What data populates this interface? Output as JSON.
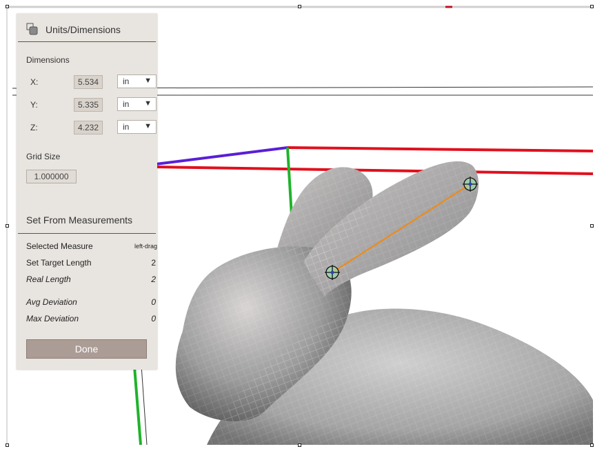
{
  "panel": {
    "title": "Units/Dimensions",
    "dimensions_heading": "Dimensions",
    "rows": [
      {
        "axis": "X:",
        "value": "5.534",
        "unit": "in"
      },
      {
        "axis": "Y:",
        "value": "5.335",
        "unit": "in"
      },
      {
        "axis": "Z:",
        "value": "4.232",
        "unit": "in"
      }
    ],
    "grid_heading": "Grid Size",
    "grid_value": "1.000000",
    "measure_heading": "Set From Measurements",
    "selected_measure": {
      "label": "Selected Measure",
      "value": "left-drag"
    },
    "target_length": {
      "label": "Set Target Length",
      "value": "2"
    },
    "real_length": {
      "label": "Real Length",
      "value": "2"
    },
    "avg_deviation": {
      "label": "Avg Deviation",
      "value": "0"
    },
    "max_deviation": {
      "label": "Max Deviation",
      "value": "0"
    },
    "done_label": "Done",
    "dropdown_arrow": "▼"
  },
  "colors": {
    "x_axis": "#e0101d",
    "y_axis": "#1fb32b",
    "z_axis": "#5a1fd6",
    "measure_line": "#f08a11",
    "panel_bg": "#e8e4df",
    "done_button": "#ab9c95"
  }
}
